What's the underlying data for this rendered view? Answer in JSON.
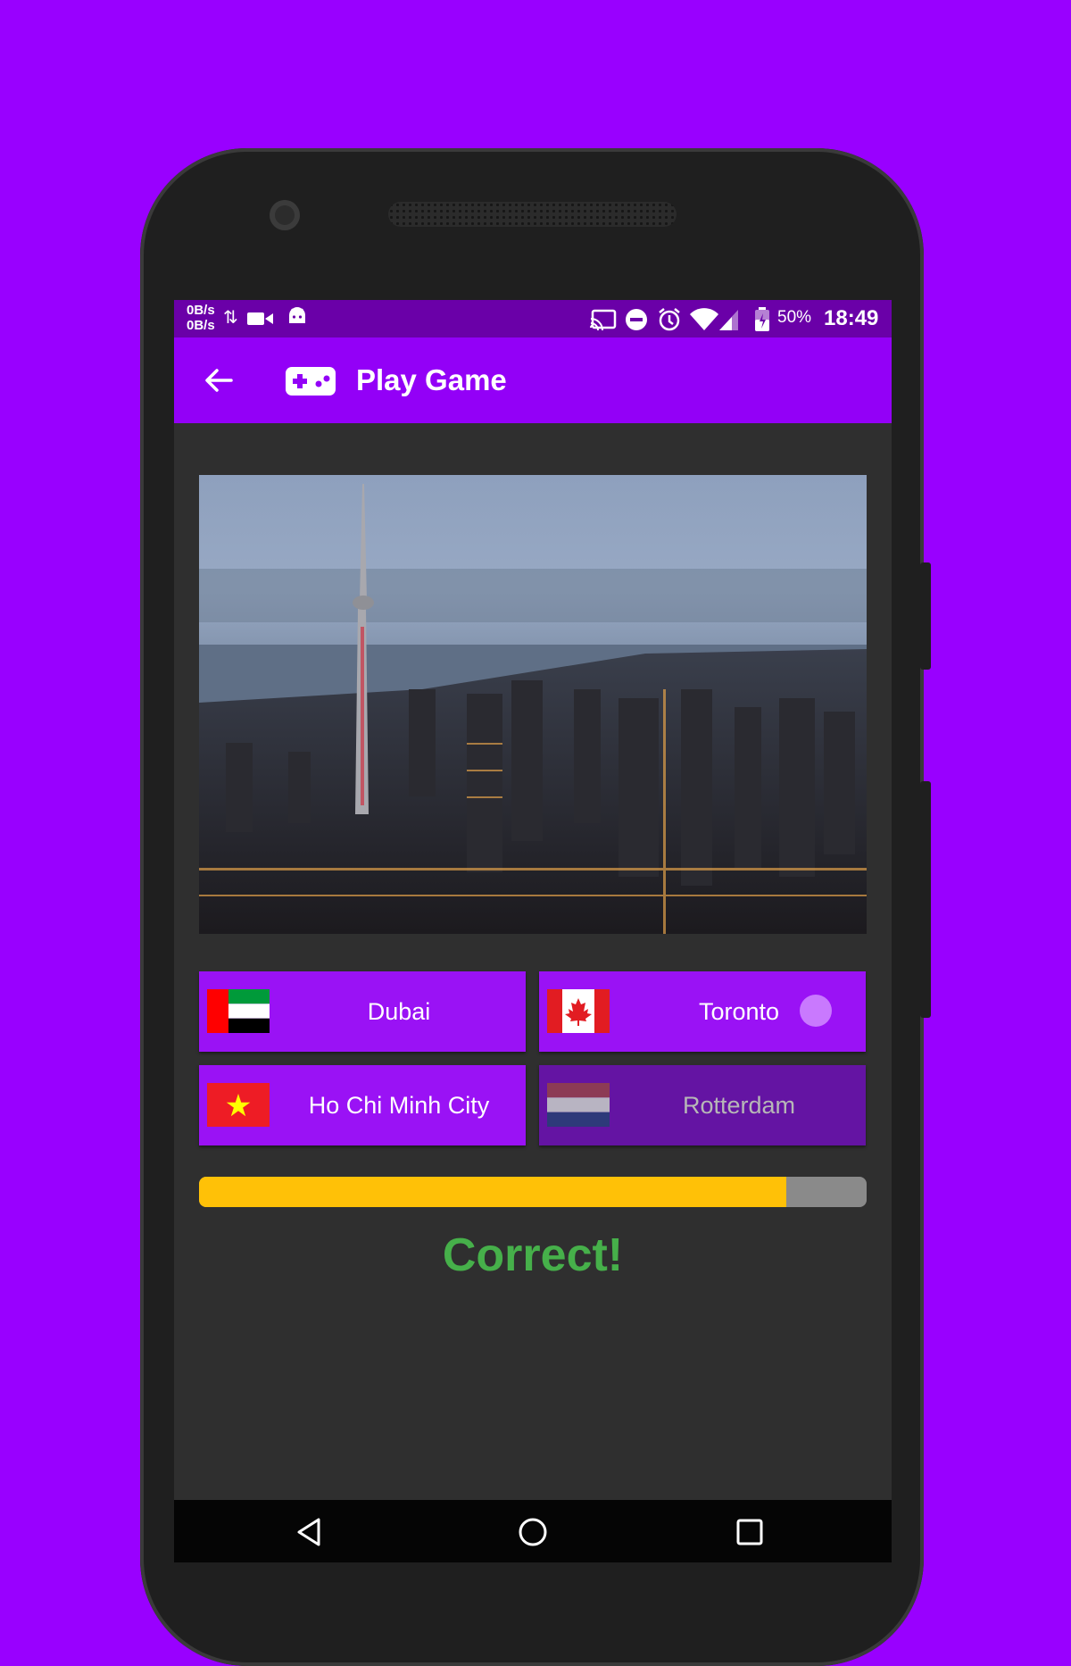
{
  "status_bar": {
    "net_up": "0B/s",
    "net_down": "0B/s",
    "battery": "50%",
    "time": "18:49"
  },
  "app_bar": {
    "title": "Play Game"
  },
  "answers": [
    {
      "label": "Dubai",
      "flag": "uae-flag",
      "state": "normal"
    },
    {
      "label": "Toronto",
      "flag": "canada-flag",
      "state": "selected"
    },
    {
      "label": "Ho Chi Minh City",
      "flag": "vietnam-flag",
      "state": "normal"
    },
    {
      "label": "Rotterdam",
      "flag": "netherlands-flag",
      "state": "disabled"
    }
  ],
  "timer": {
    "progress_fraction": 0.88
  },
  "result": {
    "text": "Correct!"
  },
  "colors": {
    "background": "#9900ff",
    "app_bar": "#9300f7",
    "status_bar": "#6a00a8",
    "button": "#9a12f5",
    "button_disabled": "#6414a3",
    "progress": "#ffc107",
    "correct": "#46b04a"
  }
}
